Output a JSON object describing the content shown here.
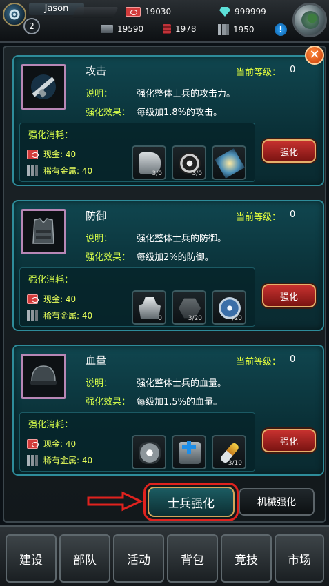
{
  "player": {
    "name": "Jason",
    "level": "2"
  },
  "resources": {
    "cash": "19030",
    "diamond": "999999",
    "steel": "19590",
    "oil": "1978",
    "metal": "1950"
  },
  "cards": [
    {
      "title": "攻击",
      "level_label": "当前等级：",
      "level_value": "0",
      "desc_label": "说明：",
      "desc_text": "强化整体士兵的攻击力。",
      "effect_label": "强化效果：",
      "effect_text": "每级加1.8%的攻击。",
      "cost_title": "强化消耗：",
      "cost_cash": "现金: 40",
      "cost_metal": "稀有金属: 40",
      "items": [
        "3/0",
        "3/0",
        ""
      ],
      "button": "强化"
    },
    {
      "title": "防御",
      "level_label": "当前等级：",
      "level_value": "0",
      "desc_label": "说明：",
      "desc_text": "强化整体士兵的防御。",
      "effect_label": "强化效果：",
      "effect_text": "每级加2%的防御。",
      "cost_title": "强化消耗：",
      "cost_cash": "现金: 40",
      "cost_metal": "稀有金属: 40",
      "items": [
        "0",
        "3/20",
        "/20"
      ],
      "button": "强化"
    },
    {
      "title": "血量",
      "level_label": "当前等级：",
      "level_value": "0",
      "desc_label": "说明：",
      "desc_text": "强化整体士兵的血量。",
      "effect_label": "强化效果：",
      "effect_text": "每级加1.5%的血量。",
      "cost_title": "强化消耗：",
      "cost_cash": "现金: 40",
      "cost_metal": "稀有金属: 40",
      "items": [
        "",
        "",
        "3/10"
      ],
      "button": "强化"
    }
  ],
  "tabs": {
    "soldier": "士兵强化",
    "mech": "机械强化"
  },
  "nav": [
    "建设",
    "部队",
    "活动",
    "背包",
    "竞技",
    "市场"
  ],
  "colors": {
    "accent_yellow": "#d8ff4a",
    "card_border": "#2e8c9a",
    "highlight_red": "#e0221e"
  }
}
